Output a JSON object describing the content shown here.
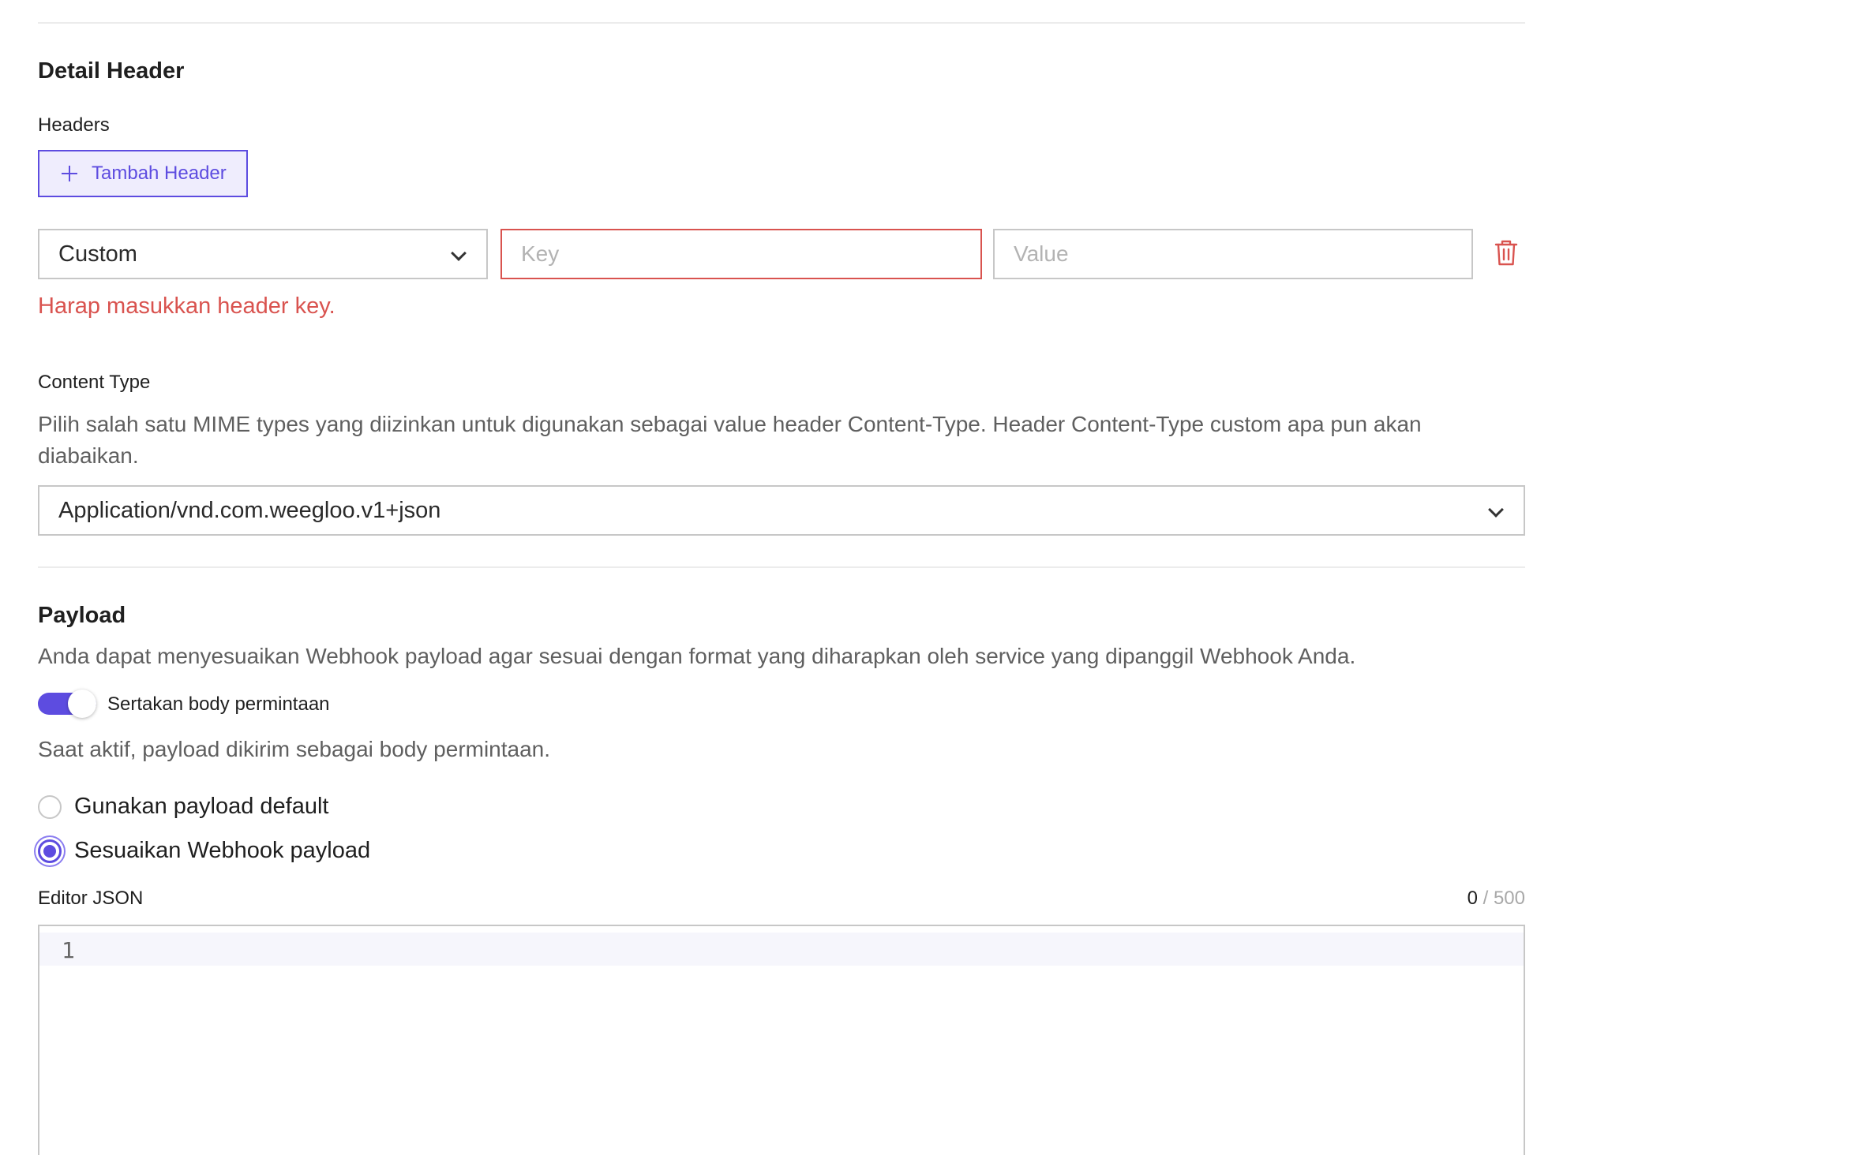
{
  "detail_header": {
    "title": "Detail Header",
    "headers_label": "Headers",
    "add_header_label": "Tambah Header",
    "row": {
      "type_selected": "Custom",
      "key_placeholder": "Key",
      "key_value": "",
      "value_placeholder": "Value",
      "value_value": ""
    },
    "error_message": "Harap masukkan header key."
  },
  "content_type": {
    "label": "Content Type",
    "description": "Pilih salah satu MIME types yang diizinkan untuk digunakan sebagai value header Content-Type. Header Content-Type custom apa pun akan diabaikan.",
    "selected": "Application/vnd.com.weegloo.v1+json"
  },
  "payload": {
    "title": "Payload",
    "description": "Anda dapat menyesuaikan Webhook payload agar sesuai dengan format yang diharapkan oleh service yang dipanggil Webhook Anda.",
    "toggle_label": "Sertakan body permintaan",
    "toggle_on": true,
    "toggle_description": "Saat aktif, payload dikirim sebagai body permintaan.",
    "options": [
      {
        "label": "Gunakan payload default",
        "checked": false
      },
      {
        "label": "Sesuaikan Webhook payload",
        "checked": true
      }
    ]
  },
  "editor": {
    "label": "Editor JSON",
    "count": "0",
    "max": "/ 500",
    "line_number": "1"
  },
  "colors": {
    "accent": "#5d4ce0",
    "error": "#d9534f",
    "border": "#c7c7c7"
  }
}
